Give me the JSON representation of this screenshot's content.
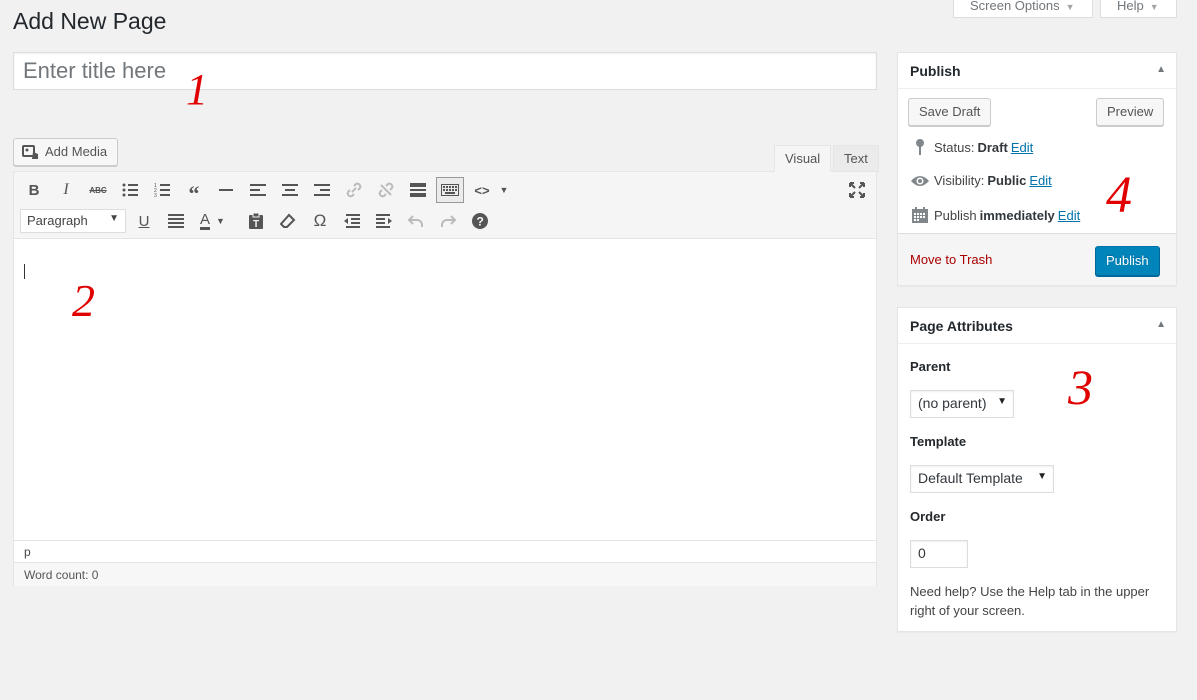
{
  "header": {
    "title": "Add New Page",
    "screen_options": "Screen Options",
    "help": "Help"
  },
  "title_field": {
    "placeholder": "Enter title here",
    "value": ""
  },
  "annotations": {
    "a1": "1",
    "a2": "2",
    "a3": "3",
    "a4": "4"
  },
  "editor": {
    "add_media": "Add Media",
    "tab_visual": "Visual",
    "tab_text": "Text",
    "format_select": "Paragraph",
    "path": "p",
    "word_count": "Word count: 0",
    "toolbar_icons_row1": [
      "bold-icon",
      "italic-icon",
      "strikethrough-icon",
      "bullet-list-icon",
      "numbered-list-icon",
      "blockquote-icon",
      "horizontal-line-icon",
      "align-left-icon",
      "align-center-icon",
      "align-right-icon",
      "link-icon",
      "unlink-icon",
      "read-more-icon",
      "toolbar-toggle-icon",
      "code-icon",
      "fullscreen-icon"
    ],
    "toolbar_icons_row2": [
      "underline-icon",
      "justify-icon",
      "text-color-icon",
      "paste-text-icon",
      "clear-formatting-icon",
      "special-character-icon",
      "outdent-icon",
      "indent-icon",
      "undo-icon",
      "redo-icon",
      "help-icon"
    ]
  },
  "publish": {
    "title": "Publish",
    "save_draft": "Save Draft",
    "preview": "Preview",
    "status_label": "Status:",
    "status_value": "Draft",
    "visibility_label": "Visibility:",
    "visibility_value": "Public",
    "publish_label": "Publish",
    "publish_value": "immediately",
    "edit": "Edit",
    "move_to_trash": "Move to Trash",
    "publish_button": "Publish"
  },
  "page_attributes": {
    "title": "Page Attributes",
    "parent_label": "Parent",
    "parent_value": "(no parent)",
    "template_label": "Template",
    "template_value": "Default Template",
    "order_label": "Order",
    "order_value": "0",
    "help_text": "Need help? Use the Help tab in the upper right of your screen."
  },
  "colors": {
    "primary": "#0085ba",
    "link": "#0073aa",
    "trash": "#a00",
    "annotation": "#e10000"
  }
}
